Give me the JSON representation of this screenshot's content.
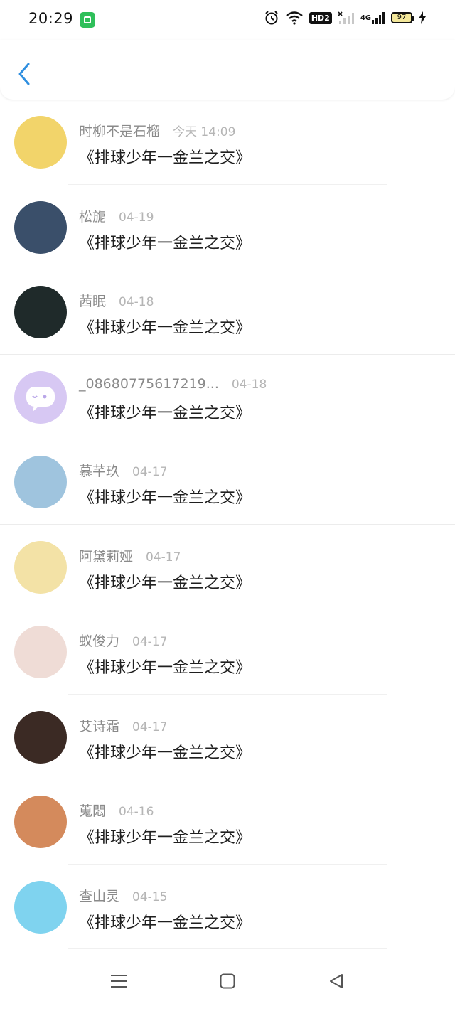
{
  "status_bar": {
    "time": "20:29",
    "hd_label": "HD2",
    "network_label": "4G",
    "battery_level": "97",
    "battery_color": "#f3e79a"
  },
  "header": {
    "back_icon": "chevron-left-icon",
    "accent_color": "#2f8fe0"
  },
  "message_text": "《排球少年一金兰之交》",
  "items": [
    {
      "username": "时柳不是石榴",
      "date": "今天 14:09",
      "message": "《排球少年一金兰之交》",
      "avatar_color": "#f2d46a"
    },
    {
      "username": "松旎",
      "date": "04-19",
      "message": "《排球少年一金兰之交》",
      "avatar_color": "#3a4f6a"
    },
    {
      "username": "茜眠",
      "date": "04-18",
      "message": "《排球少年一金兰之交》",
      "avatar_color": "#1f2a2a"
    },
    {
      "username": "_08680775617219...",
      "date": "04-18",
      "message": "《排球少年一金兰之交》",
      "avatar_color": "#d7c8f3"
    },
    {
      "username": "慕芊玖",
      "date": "04-17",
      "message": "《排球少年一金兰之交》",
      "avatar_color": "#9fc4de"
    },
    {
      "username": "阿黛莉娅",
      "date": "04-17",
      "message": "《排球少年一金兰之交》",
      "avatar_color": "#f3e2a6"
    },
    {
      "username": "蚁俊力",
      "date": "04-17",
      "message": "《排球少年一金兰之交》",
      "avatar_color": "#efdcd6"
    },
    {
      "username": "艾诗霜",
      "date": "04-17",
      "message": "《排球少年一金兰之交》",
      "avatar_color": "#3b2a24"
    },
    {
      "username": "蒐悶",
      "date": "04-16",
      "message": "《排球少年一金兰之交》",
      "avatar_color": "#d48a5c"
    },
    {
      "username": "查山灵",
      "date": "04-15",
      "message": "《排球少年一金兰之交》",
      "avatar_color": "#7fd3ef"
    }
  ],
  "nav_bar": {
    "menu_icon": "menu-icon",
    "home_icon": "home-square-icon",
    "back_icon": "back-triangle-icon"
  }
}
